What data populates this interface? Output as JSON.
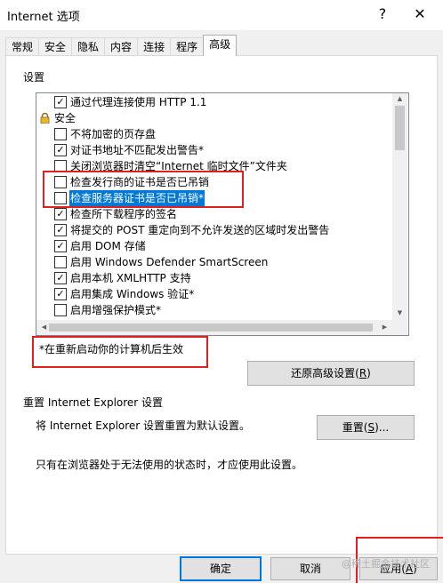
{
  "window": {
    "title": "Internet 选项",
    "help_label": "?",
    "close_label": "✕"
  },
  "tabs": [
    {
      "label": "常规"
    },
    {
      "label": "安全"
    },
    {
      "label": "隐私"
    },
    {
      "label": "内容"
    },
    {
      "label": "连接"
    },
    {
      "label": "程序"
    },
    {
      "label": "高级",
      "active": true
    }
  ],
  "settings": {
    "section_label": "设置",
    "items": [
      {
        "label": "通过代理连接使用 HTTP 1.1",
        "checked": true
      },
      {
        "label": "安全",
        "group": true,
        "icon": "lock-icon"
      },
      {
        "label": "不将加密的页存盘",
        "checked": false
      },
      {
        "label": "对证书地址不匹配发出警告*",
        "checked": true
      },
      {
        "label": "关闭浏览器时清空“Internet 临时文件”文件夹",
        "checked": false
      },
      {
        "label": "检查发行商的证书是否已吊销",
        "checked": false
      },
      {
        "label": "检查服务器证书是否已吊销*",
        "checked": false,
        "selected": true
      },
      {
        "label": "检查所下载程序的签名",
        "checked": true
      },
      {
        "label": "将提交的 POST 重定向到不允许发送的区域时发出警告",
        "checked": true
      },
      {
        "label": "启用 DOM 存储",
        "checked": true
      },
      {
        "label": "启用 Windows Defender SmartScreen",
        "checked": false
      },
      {
        "label": "启用本机 XMLHTTP 支持",
        "checked": true
      },
      {
        "label": "启用集成 Windows 验证*",
        "checked": true
      },
      {
        "label": "启用增强保护模式*",
        "checked": false
      }
    ],
    "restart_note": "*在重新启动你的计算机后生效",
    "restore_button": "还原高级设置(R)",
    "restore_button_main": "还原高级设置(",
    "restore_button_key": "R",
    "restore_button_end": ")"
  },
  "reset": {
    "section_label": "重置 Internet Explorer 设置",
    "description": "将 Internet Explorer 设置重置为默认设置。",
    "button_main": "重置(",
    "button_key": "S",
    "button_end": ")...",
    "note": "只有在浏览器处于无法使用的状态时，才应使用此设置。"
  },
  "footer": {
    "ok": "确定",
    "cancel": "取消",
    "apply_main": "应用(",
    "apply_key": "A",
    "apply_end": ")"
  },
  "watermark": "@稀土掘金技术社区",
  "colors": {
    "highlight": "#0078d7",
    "annotation": "#e02020"
  }
}
